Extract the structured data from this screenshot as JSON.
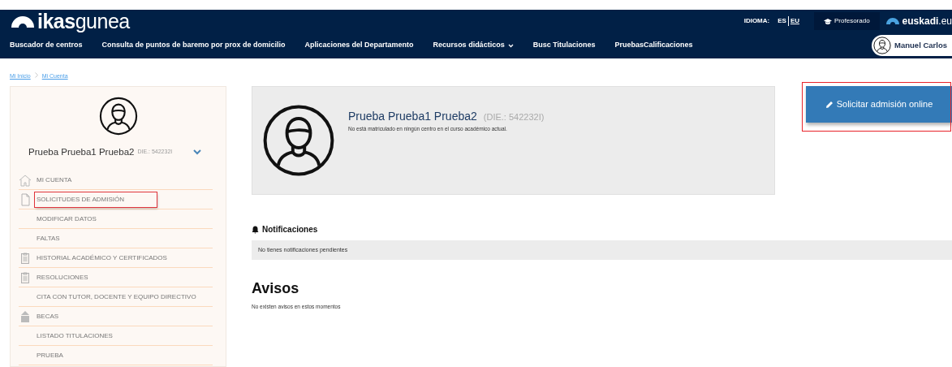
{
  "header": {
    "logo": {
      "bold": "ikas",
      "light": "gunea"
    },
    "language_label": "IDIOMA:",
    "languages": [
      {
        "code": "ES",
        "selected": true
      },
      {
        "code": "EU",
        "selected": false
      }
    ],
    "role_link": "Profesorado",
    "brand": "**euskadi**.eu"
  },
  "nav": [
    {
      "label": "Buscador de centros",
      "dropdown": false
    },
    {
      "label": "Consulta de puntos de baremo por prox de domicilio",
      "dropdown": false
    },
    {
      "label": "Aplicaciones del Departamento",
      "dropdown": false
    },
    {
      "label": "Recursos didácticos",
      "dropdown": true
    },
    {
      "label": "Busc Titulaciones",
      "dropdown": false
    },
    {
      "label": "PruebasCalificaciones",
      "dropdown": false
    }
  ],
  "user": {
    "name": "Manuel Carlos"
  },
  "breadcrumb": [
    "Mi Inicio",
    "Mi Cuenta"
  ],
  "sidebar": {
    "name": "Prueba Prueba1 Prueba2",
    "die": "DIE.: 542232I",
    "expanded": false,
    "items": [
      {
        "label": "MI CUENTA",
        "kind": "home",
        "highlighted": false
      },
      {
        "label": "SOLICITUDES DE ADMISIÓN",
        "kind": "document",
        "highlighted": true
      },
      {
        "label": "MODIFICAR DATOS",
        "kind": "plain",
        "highlighted": false
      },
      {
        "label": "FALTAS",
        "kind": "plain",
        "highlighted": false
      },
      {
        "label": "HISTORIAL ACADÉMICO Y CERTIFICADOS",
        "kind": "clipboard",
        "highlighted": false
      },
      {
        "label": "RESOLUCIONES",
        "kind": "clipboard",
        "highlighted": false
      },
      {
        "label": "CITA CON TUTOR, DOCENTE Y EQUIPO DIRECTIVO",
        "kind": "plain",
        "highlighted": false
      },
      {
        "label": "BECAS",
        "kind": "building",
        "highlighted": false
      },
      {
        "label": "LISTADO TITULACIONES",
        "kind": "plain",
        "highlighted": false
      },
      {
        "label": "PRUEBA",
        "kind": "plain",
        "highlighted": false
      }
    ]
  },
  "profile": {
    "name": "Prueba Prueba1  Prueba2",
    "die": "(DIE.: 542232I)",
    "status": "No está matriculado en ningún centro en el curso académico actual."
  },
  "action_button": {
    "label": "Solicitar admisión online",
    "highlighted": true
  },
  "notifications": {
    "title": "Notificaciones",
    "message": "No tienes notificaciones pendientes"
  },
  "notices": {
    "title": "Avisos",
    "message": "No existen avisos en estos momentos"
  }
}
